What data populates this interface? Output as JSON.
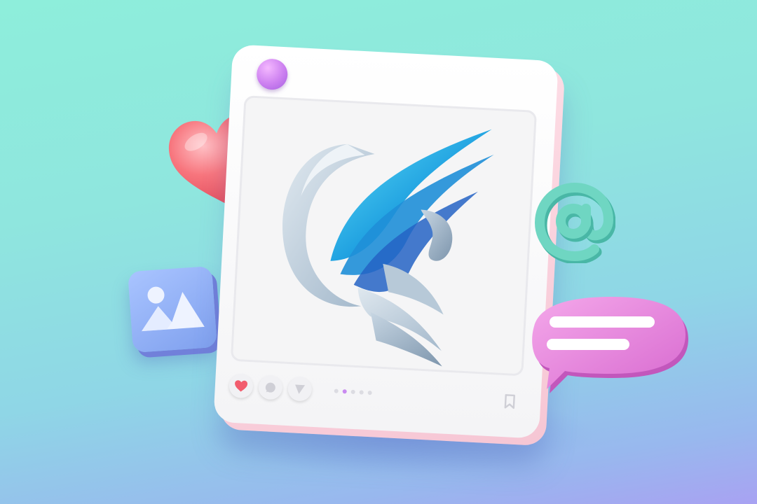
{
  "scene": {
    "background_colors": [
      "#8eeedb",
      "#8fd6e6",
      "#a8a2f2"
    ],
    "card_color": "#ffffff",
    "card_edge_color": "#f6c6d4"
  },
  "post": {
    "avatar_color": "#cc80f0",
    "photo_logo_colors": [
      "#1ea8e0",
      "#2c6bd0",
      "#b9cfe0",
      "#a8bccd"
    ],
    "actions": [
      {
        "name": "like",
        "icon": "heart-icon",
        "color": "#f25d6e"
      },
      {
        "name": "comment",
        "icon": "comment-icon",
        "color": "#cfcfd6"
      },
      {
        "name": "share",
        "icon": "send-icon",
        "color": "#cfcfd6"
      }
    ],
    "carousel": {
      "total": 5,
      "active_index": 1,
      "active_color": "#c98af0"
    },
    "bookmark_icon": "bookmark-icon"
  },
  "floating": {
    "heart": {
      "icon": "heart-icon",
      "color": "#f26b75"
    },
    "image_tile": {
      "icon": "image-icon",
      "color": "#8fb0f6"
    },
    "at_sign": {
      "icon": "at-sign-icon",
      "color": "#5fc9b6"
    },
    "chat_bubble": {
      "icon": "chat-bubble-icon",
      "color": "#e783d8"
    }
  }
}
